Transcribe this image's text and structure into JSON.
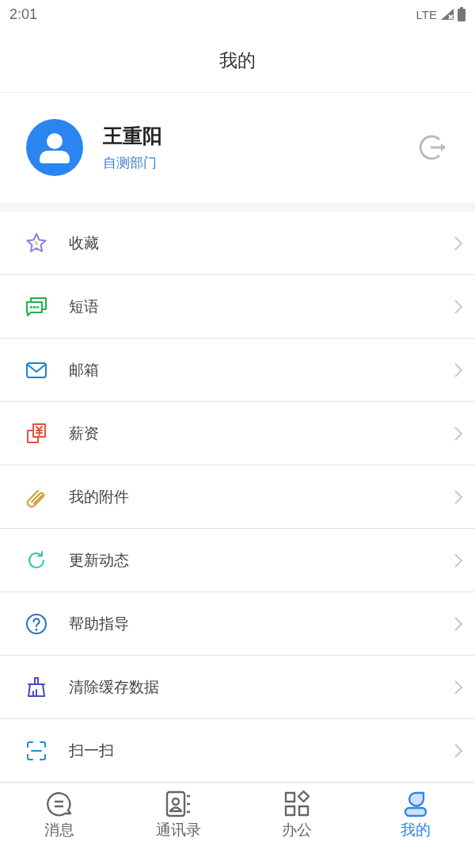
{
  "status_bar": {
    "time": "2:01",
    "network": "LTE"
  },
  "header": {
    "title": "我的"
  },
  "profile": {
    "name": "王重阳",
    "department": "自测部门"
  },
  "menu": [
    {
      "label": "收藏",
      "kind": "star",
      "color": "#8b7fe0"
    },
    {
      "label": "短语",
      "kind": "chat",
      "color": "#22b04a"
    },
    {
      "label": "邮箱",
      "kind": "mail",
      "color": "#1f7fd0"
    },
    {
      "label": "薪资",
      "kind": "salary",
      "color": "#e0553a"
    },
    {
      "label": "我的附件",
      "kind": "clip",
      "color": "#d09a30"
    },
    {
      "label": "更新动态",
      "kind": "refresh",
      "color": "#2cc7b0"
    },
    {
      "label": "帮助指导",
      "kind": "help",
      "color": "#2a6fc8"
    },
    {
      "label": "清除缓存数据",
      "kind": "broom",
      "color": "#4a48c8"
    },
    {
      "label": "扫一扫",
      "kind": "scan",
      "color": "#2a8ad0"
    }
  ],
  "tabs": [
    {
      "label": "消息",
      "kind": "message",
      "selected": false
    },
    {
      "label": "通讯录",
      "kind": "contacts",
      "selected": false
    },
    {
      "label": "办公",
      "kind": "office",
      "selected": false
    },
    {
      "label": "我的",
      "kind": "me",
      "selected": true
    }
  ]
}
